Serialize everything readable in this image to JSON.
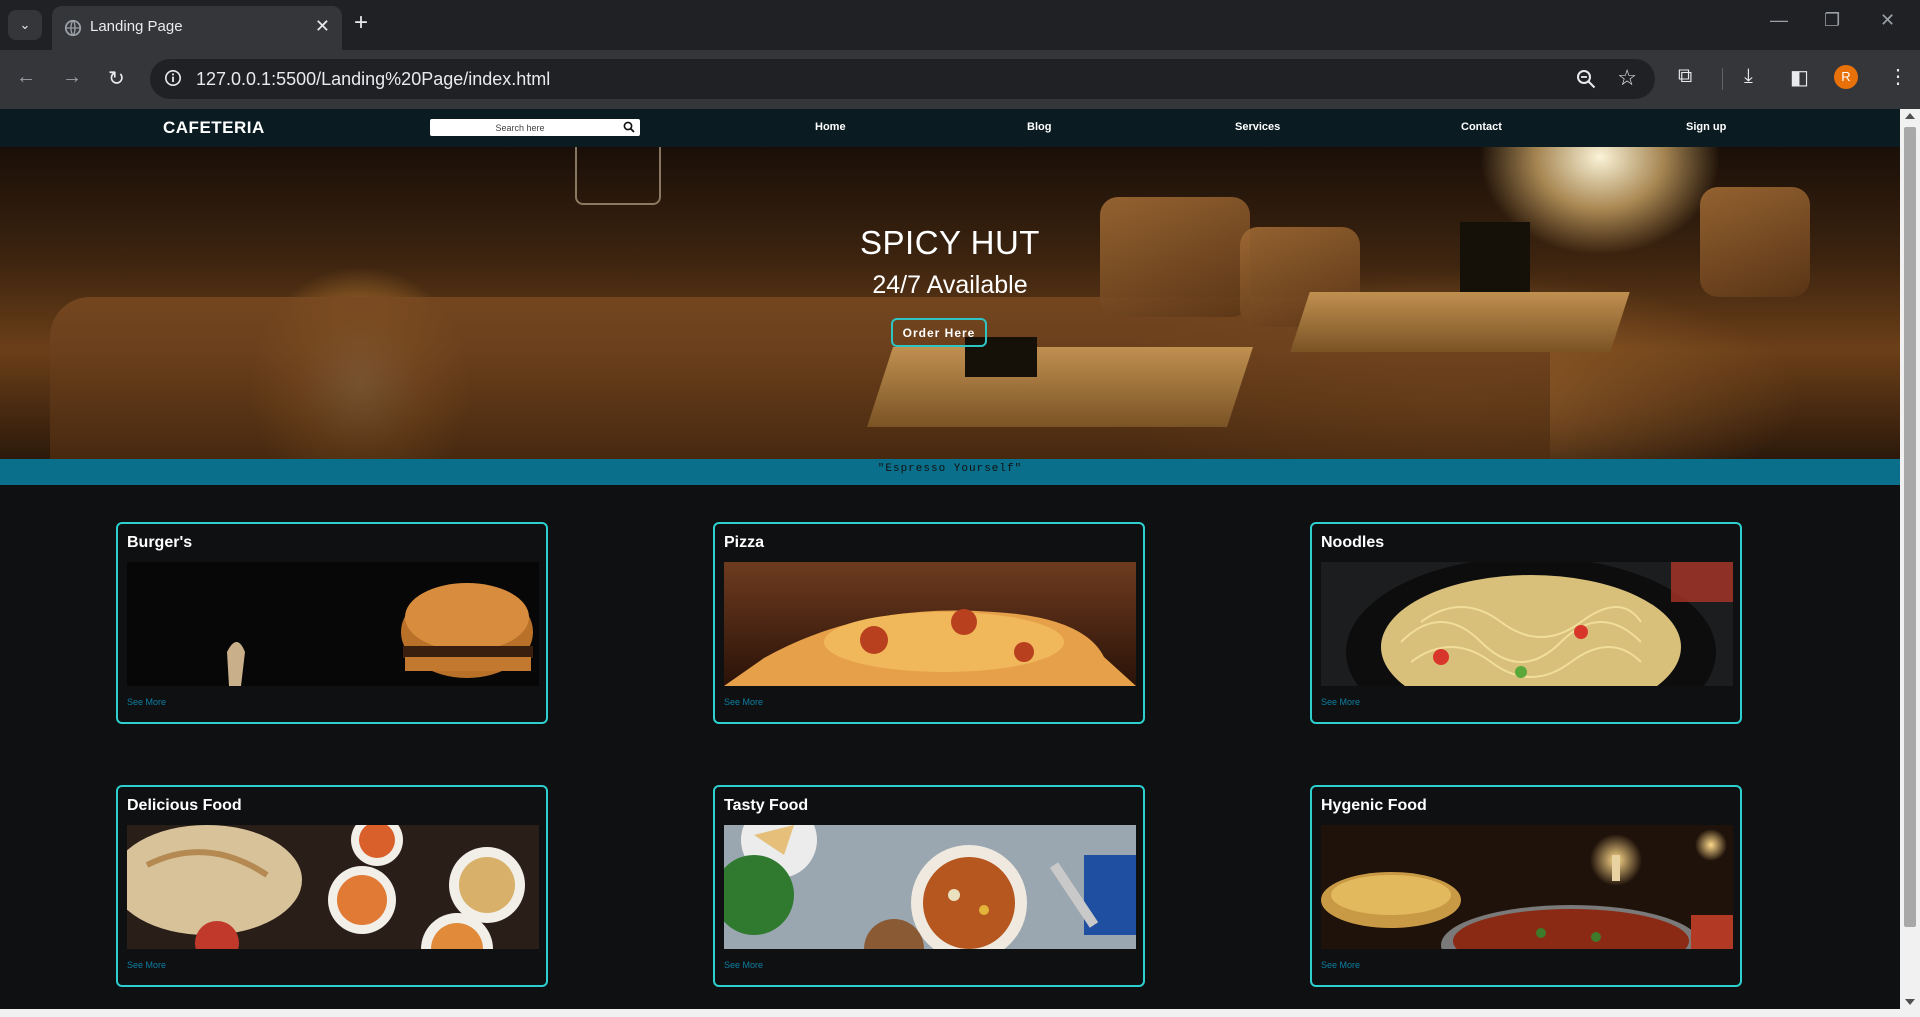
{
  "browser": {
    "tab_title": "Landing Page",
    "tab_close": "✕",
    "new_tab": "+",
    "url": "127.0.0.1:5500/Landing%20Page/index.html",
    "profile_initial": "R",
    "window_controls": [
      "—",
      "❐",
      "✕"
    ],
    "icons": [
      "tab-search-icon",
      "globe-icon",
      "back-icon",
      "forward-icon",
      "reload-icon",
      "site-info-icon",
      "zoom-icon",
      "bookmark-star-icon",
      "extensions-icon",
      "download-icon",
      "side-panel-icon",
      "menu-icon"
    ]
  },
  "site": {
    "logo": "CAFETERIA",
    "search_placeholder": "Search here",
    "nav": [
      "Home",
      "Blog",
      "Services",
      "Contact",
      "Sign up"
    ],
    "hero": {
      "title": "SPICY HUT",
      "subtitle": "24/7 Available",
      "button": "Order Here"
    },
    "tagline": "\"Espresso Yourself\"",
    "cards": [
      {
        "title": "Burger's",
        "link": "See More"
      },
      {
        "title": "Pizza",
        "link": "See More"
      },
      {
        "title": "Noodles",
        "link": "See More"
      },
      {
        "title": "Delicious Food",
        "link": "See More"
      },
      {
        "title": "Tasty Food",
        "link": "See More"
      },
      {
        "title": "Hygenic Food",
        "link": "See More"
      }
    ],
    "colors": {
      "accent": "#2dcfcf",
      "nav_bg": "#0a1c22",
      "tagline_bg": "#0a6f8a",
      "page_bg": "#0e1011",
      "link": "#0f7fa3"
    }
  }
}
